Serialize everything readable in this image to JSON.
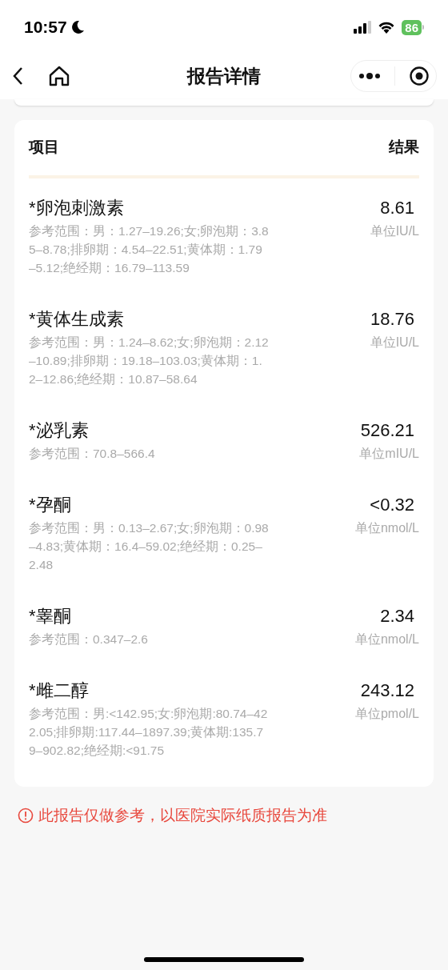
{
  "status_bar": {
    "time": "10:57",
    "battery": "86"
  },
  "nav": {
    "title": "报告详情"
  },
  "table": {
    "columns": [
      "项目",
      "结果"
    ],
    "rows": [
      {
        "name": "*卵泡刺激素",
        "range": "参考范围：男：1.27–19.26;女;卵泡期：3.85–8.78;排卵期：4.54–22.51;黄体期：1.79–5.12;绝经期：16.79–113.59",
        "value": "8.61",
        "unit": "单位IU/L"
      },
      {
        "name": "*黄体生成素",
        "range": "参考范围：男：1.24–8.62;女;卵泡期：2.12–10.89;排卵期：19.18–103.03;黄体期：1.2–12.86;绝经期：10.87–58.64",
        "value": "18.76",
        "unit": "单位IU/L"
      },
      {
        "name": "*泌乳素",
        "range": "参考范围：70.8–566.4",
        "value": "526.21",
        "unit": "单位mIU/L"
      },
      {
        "name": "*孕酮",
        "range": "参考范围：男：0.13–2.67;女;卵泡期：0.98–4.83;黄体期：16.4–59.02;绝经期：0.25–2.48",
        "value": "<0.32",
        "unit": "单位nmol/L"
      },
      {
        "name": "*睾酮",
        "range": "参考范围：0.347–2.6",
        "value": "2.34",
        "unit": "单位nmol/L"
      },
      {
        "name": "*雌二醇",
        "range": "参考范围：男:<142.95;女:卵泡期:80.74–422.05;排卵期:117.44–1897.39;黄体期:135.79–902.82;绝经期:<91.75",
        "value": "243.12",
        "unit": "单位pmol/L"
      }
    ]
  },
  "notice": "此报告仅做参考，以医院实际纸质报告为准"
}
